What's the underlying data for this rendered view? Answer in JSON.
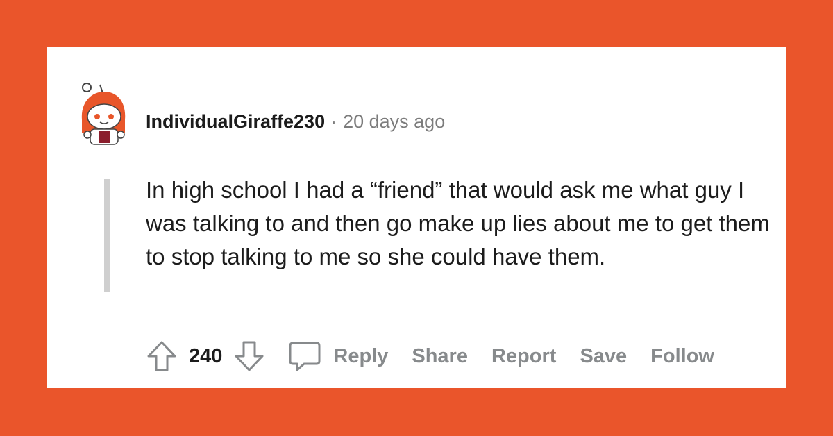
{
  "comment": {
    "author": "IndividualGiraffe230",
    "separator": "·",
    "timestamp": "20 days ago",
    "body": "In high school I had a “friend” that would ask me what guy I was talking to and then go make up lies about me to get them to stop talking to me so she could have them.",
    "vote_count": "240"
  },
  "actions": {
    "reply": "Reply",
    "share": "Share",
    "report": "Report",
    "save": "Save",
    "follow": "Follow"
  },
  "icons": {
    "avatar": "snoo-avatar-icon",
    "upvote": "upvote-arrow-icon",
    "downvote": "downvote-arrow-icon",
    "comment": "speech-bubble-icon"
  },
  "colors": {
    "background": "#ea552b",
    "card": "#ffffff",
    "text": "#1c1c1c",
    "muted": "#878a8c",
    "thread_line": "#cfcfcf",
    "avatar_hood": "#e8562a"
  }
}
